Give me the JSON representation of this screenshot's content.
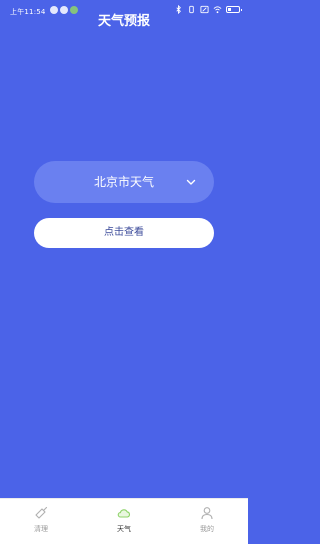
{
  "status_bar": {
    "time": "上午11:54",
    "battery_level": 0.3
  },
  "header": {
    "title": "天气预报"
  },
  "city_select": {
    "label": "北京市天气",
    "icon": "chevron-down-icon"
  },
  "actions": {
    "view_label": "点击查看"
  },
  "tabs": [
    {
      "label": "清理",
      "icon": "broom-icon",
      "active": false
    },
    {
      "label": "天气",
      "icon": "cloud-icon",
      "active": true
    },
    {
      "label": "我的",
      "icon": "user-icon",
      "active": false
    }
  ],
  "colors": {
    "background": "#4b63e8",
    "select_bg": "#6a80f0",
    "accent_green": "#8fd36a"
  }
}
